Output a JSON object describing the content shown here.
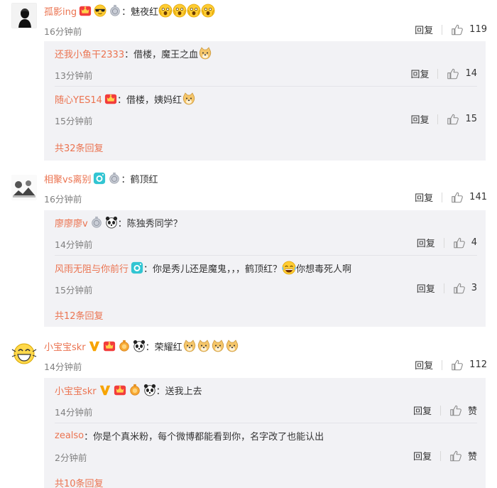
{
  "threads": [
    {
      "user": "孤影ing",
      "text": "：魅夜红",
      "time": "16分钟前",
      "reply": "回复",
      "likes": "119",
      "replies": [
        {
          "user": "还我小鱼干2333",
          "text": "：借楼，魔王之血",
          "time": "13分钟前",
          "reply": "回复",
          "likes": "14"
        },
        {
          "user": "随心YES14",
          "text": "：借楼，姨妈红",
          "time": "15分钟前",
          "reply": "回复",
          "likes": "15"
        }
      ],
      "more": "共32条回复"
    },
    {
      "user": "相聚vs离别",
      "text": "：鹤顶红",
      "time": "16分钟前",
      "reply": "回复",
      "likes": "141",
      "replies": [
        {
          "user": "廖廖廖v",
          "text": "：陈独秀同学？",
          "time": "14分钟前",
          "reply": "回复",
          "likes": "4"
        },
        {
          "user": "风雨无阻与你前行",
          "text": "：你是秀儿还是魔鬼，，，鹤顶红？",
          "text2": "你想毒死人啊",
          "time": "15分钟前",
          "reply": "回复",
          "likes": "3"
        }
      ],
      "more": "共12条回复"
    },
    {
      "user": "小宝宝skr",
      "text": "：荣耀红",
      "time": "14分钟前",
      "reply": "回复",
      "likes": "112",
      "replies": [
        {
          "user": "小宝宝skr",
          "text": "：送我上去",
          "time": "14分钟前",
          "reply": "回复",
          "likes": "赞"
        },
        {
          "user": "zealso",
          "text": "：你是个真米粉，每个微博都能看到你，名字改了也能认出",
          "time": "2分钟前",
          "reply": "回复",
          "likes": "赞"
        }
      ],
      "more": "共10条回复"
    }
  ],
  "icons": {
    "like": "thumbs-up-icon",
    "vip": "vip-crown-icon",
    "medal": "silver-medal-icon",
    "gold_medal": "gold-medal-icon",
    "panda": "panda-icon",
    "camera": "camera-badge-icon",
    "v_badge": "orange-v-icon",
    "emoji_scared": "scared-emoji-icon",
    "emoji_doge": "doge-emoji-icon",
    "emoji_laugh": "laugh-emoji-icon",
    "sunglasses": "sunglasses-emoji-icon"
  },
  "colors": {
    "username": "#eb7350",
    "subbg": "#f2f2f5",
    "time": "#808080"
  }
}
